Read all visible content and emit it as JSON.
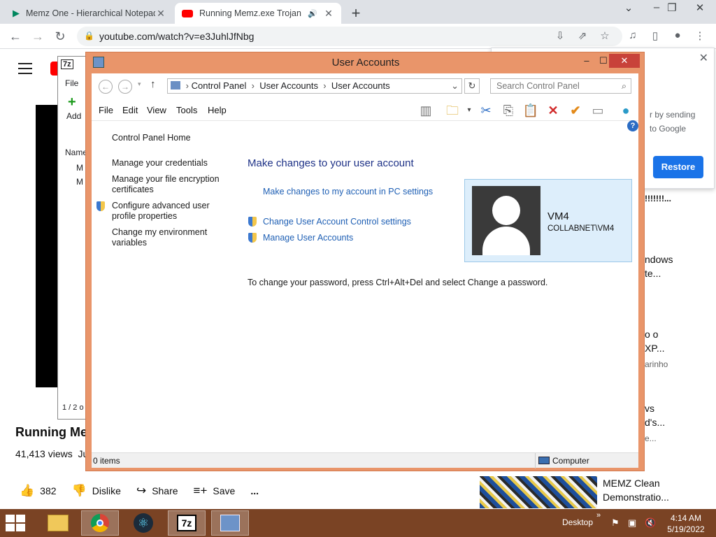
{
  "browser": {
    "tabs": [
      {
        "title": "Memz One - Hierarchical Notepad"
      },
      {
        "title": "Running Memz.exe Trojan on"
      }
    ],
    "url": "youtube.com/watch?v=e3JuhlJfNbg"
  },
  "youtube": {
    "video_title": "Running Mem",
    "views": "41,413 views",
    "views_extra": "Ju",
    "actions": {
      "likes": "382",
      "dislike": "Dislike",
      "share": "Share",
      "save": "Save",
      "more": "..."
    },
    "signin_popup": {
      "line1": "r by sending",
      "line2": "to Google",
      "restore": "Restore"
    },
    "sidebar": [
      {
        "text": "!!!!!!!..."
      },
      {
        "text": "ndows"
      },
      {
        "text": "te..."
      },
      {
        "text": "o o"
      },
      {
        "text": "XP..."
      },
      {
        "text": "arinho"
      },
      {
        "text": "vs"
      },
      {
        "text": "d's..."
      },
      {
        "text": "e..."
      }
    ],
    "recommended": {
      "line1": "MEMZ Clean",
      "line2": "Demonstratio..."
    }
  },
  "zip7": {
    "menu_file": "File",
    "add": "Add",
    "column": "Name",
    "rows": [
      "M",
      "M"
    ],
    "status": "1 / 2 o"
  },
  "window": {
    "title": "User Accounts",
    "address": {
      "seg1": "Control Panel",
      "seg2": "User Accounts",
      "seg3": "User Accounts"
    },
    "search_placeholder": "Search Control Panel",
    "menu": [
      "File",
      "Edit",
      "View",
      "Tools",
      "Help"
    ],
    "left_nav": {
      "home": "Control Panel Home",
      "credentials": "Manage your credentials",
      "encryption": "Manage your file encryption certificates",
      "profile": "Configure advanced user profile properties",
      "environment": "Change my environment variables"
    },
    "heading": "Make changes to your user account",
    "links": {
      "pc_settings": "Make changes to my account in PC settings",
      "uac": "Change User Account Control settings",
      "manage": "Manage User Accounts"
    },
    "password_note": "To change your password, press Ctrl+Alt+Del and select Change a password.",
    "account": {
      "name": "VM4",
      "domain": "COLLABNET\\VM4"
    },
    "status": {
      "count": "0 items",
      "location": "Computer"
    }
  },
  "taskbar": {
    "desktop": "Desktop",
    "chevron": "»",
    "time": "4:14 AM",
    "date": "5/19/2022"
  },
  "colors": {
    "titlebar": "#e9956a",
    "taskbar": "#7a4324",
    "link": "#1e5fb4",
    "heading": "#1e3287"
  }
}
